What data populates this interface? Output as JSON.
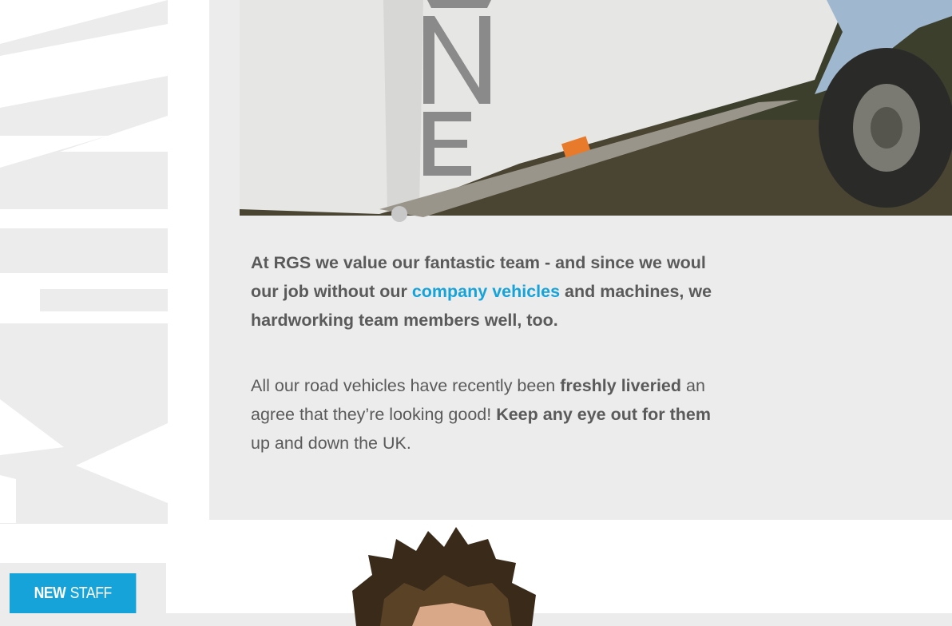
{
  "watermark": {
    "text": "ENV"
  },
  "photo": {
    "alt": "White company trailer with ENVI livery",
    "trailer_text": "ENVI"
  },
  "lead": {
    "before": "At RGS we value our fantastic team - and since we woul",
    "line2_before": "our job without our ",
    "link": "company vehicles",
    "line2_after": " and machines, we",
    "line3": "hardworking team members well, too."
  },
  "body": {
    "line1_before": "All our road vehicles have recently been ",
    "line1_bold": "freshly liveried",
    "line1_after": " an",
    "line2_before": "agree that they’re looking good! ",
    "line2_bold": "Keep any eye out for them",
    "line3": "up and down the UK."
  },
  "badge": {
    "strong": "NEW",
    "rest": "STAFF"
  },
  "colors": {
    "accent": "#16a3da",
    "text": "#5a5a5a",
    "panel": "#ececec"
  }
}
